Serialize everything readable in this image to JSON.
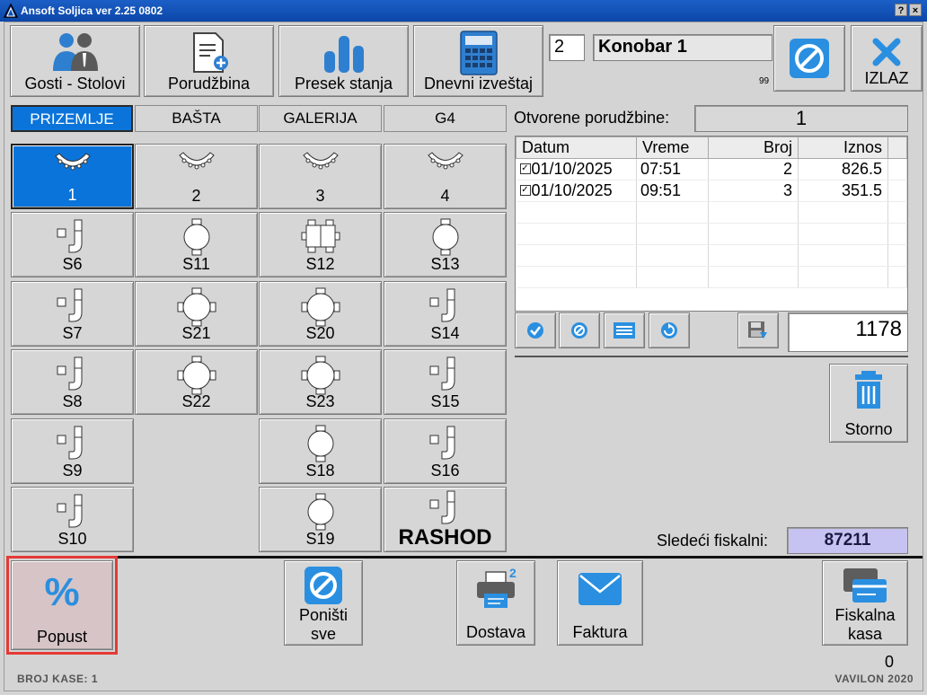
{
  "window": {
    "title": "Ansoft Soljica ver 2.25 0802",
    "help": "?",
    "close": "×"
  },
  "toolbar": {
    "guests": "Gosti - Stolovi",
    "order": "Porudžbina",
    "snapshot": "Presek stanja",
    "daily": "Dnevni izveštaj",
    "exit": "IZLAZ"
  },
  "waiter": {
    "number": "2",
    "name": "Konobar 1",
    "code": "99"
  },
  "tabs": [
    "PRIZEMLJE",
    "BAŠTA",
    "GALERIJA",
    "G4"
  ],
  "tiles": {
    "t1": "1",
    "t2": "2",
    "t3": "3",
    "t4": "4",
    "s6": "S6",
    "s11": "S11",
    "s12": "S12",
    "s13": "S13",
    "s7": "S7",
    "s21": "S21",
    "s20": "S20",
    "s14": "S14",
    "s8": "S8",
    "s22": "S22",
    "s23": "S23",
    "s15": "S15",
    "s9": "S9",
    "s18": "S18",
    "s16": "S16",
    "s10": "S10",
    "s19": "S19",
    "rashod": "RASHOD"
  },
  "orders": {
    "label": "Otvorene porudžbine:",
    "count": "1",
    "columns": [
      "Datum",
      "Vreme",
      "Broj",
      "Iznos"
    ],
    "rows": [
      {
        "datum": "01/10/2025",
        "vreme": "07:51",
        "broj": "2",
        "iznos": "826.5"
      },
      {
        "datum": "01/10/2025",
        "vreme": "09:51",
        "broj": "3",
        "iznos": "351.5"
      }
    ],
    "total": "1178"
  },
  "storno": "Storno",
  "fiscal": {
    "label": "Sledeći fiskalni:",
    "value": "87211"
  },
  "bottom": {
    "discount": "Popust",
    "cancel_line1": "Poništi",
    "cancel_line2": "sve",
    "delivery": "Dostava",
    "invoice": "Faktura",
    "fiscal_line1": "Fiskalna",
    "fiscal_line2": "kasa",
    "counter": "0"
  },
  "status": {
    "register": "BROJ KASE: 1",
    "brand": "VAVILON 2020"
  },
  "colors": {
    "accent": "#0a74da",
    "fiscal_bg": "#c6c3f2",
    "discount_border": "#e53935",
    "discount_bg": "#d7c4c6"
  }
}
